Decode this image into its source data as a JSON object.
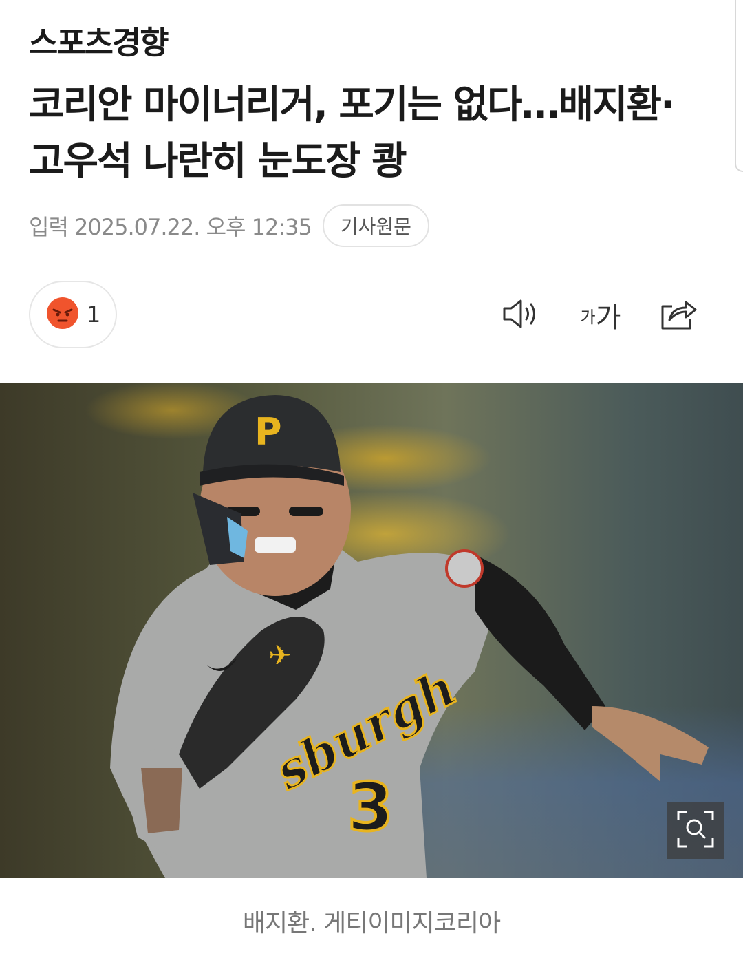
{
  "header": {
    "logo_text": "스포츠경향"
  },
  "article": {
    "headline_line1": "코리안 마이너리거, 포기는 없다…배지환·",
    "headline_line2": "고우석 나란히 눈도장 쾅",
    "date": "입력 2025.07.22. 오후 12:35",
    "original_button": "기사원문"
  },
  "reaction": {
    "icon": "angry-face-icon",
    "count": "1"
  },
  "toolbar": {
    "tts_icon": "speaker-icon",
    "font_small": "가",
    "font_large": "가",
    "share_icon": "share-icon"
  },
  "photo": {
    "cap_letter": "P",
    "jersey_script": "sburgh",
    "jersey_number": "3",
    "zoom_icon": "zoom-search-icon",
    "caption": "배지환. 게티이미지코리아"
  },
  "colors": {
    "angry": "#f0542d",
    "accent_gold": "#e8b41f",
    "text_meta": "#8a8a8a"
  }
}
